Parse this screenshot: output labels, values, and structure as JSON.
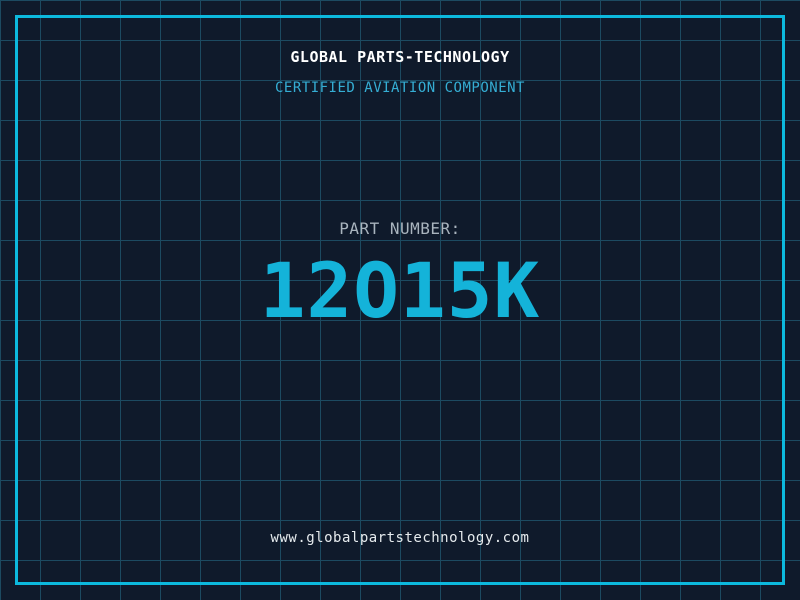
{
  "page": {
    "background_color": "#0f1a2b",
    "grid_color": "#1c4a61",
    "grid_size_px": 40,
    "frame_color": "#0cb9dd"
  },
  "header": {
    "title": "GLOBAL PARTS-TECHNOLOGY",
    "title_color": "#ffffff",
    "subtitle": "CERTIFIED AVIATION COMPONENT",
    "subtitle_color": "#35aed4"
  },
  "part": {
    "label": "PART NUMBER:",
    "label_color": "#a9b4be",
    "number": "12O15K",
    "number_color": "#14b3d9"
  },
  "footer": {
    "website": "www.globalpartstechnology.com",
    "website_color": "#e6ebee"
  }
}
